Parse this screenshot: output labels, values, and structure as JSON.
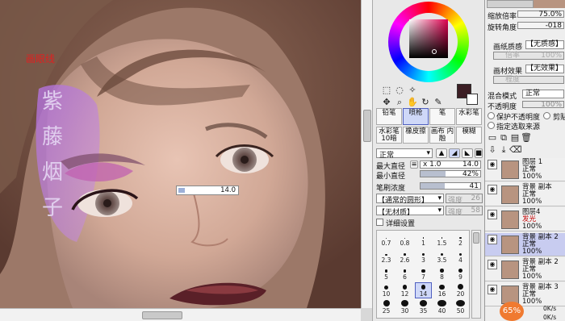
{
  "canvas": {
    "annotation_red": "画眼线",
    "annotation_purple": "紫 藤 烟 子",
    "size_popup": "14.0"
  },
  "color_panel": {
    "main_color": "#3c1e24"
  },
  "tool_panel": {
    "brush_tools": [
      {
        "label": "铅笔",
        "selected": false
      },
      {
        "label": "喷枪",
        "selected": true
      },
      {
        "label": "笔",
        "selected": false
      },
      {
        "label": "水彩笔",
        "selected": false
      },
      {
        "label": "水彩笔 10暗",
        "selected": false
      },
      {
        "label": "橡皮擦",
        "selected": false
      },
      {
        "label": "画布 内融",
        "selected": false
      },
      {
        "label": "模糊",
        "selected": false
      }
    ],
    "blend_mode": "正常",
    "max_diameter_label": "最大直径",
    "max_diameter_mult": "x 1.0",
    "max_diameter_value": "14.0",
    "min_diameter_label": "最小直径",
    "min_diameter_value": "42%",
    "min_diameter_fraction": 0.42,
    "density_label": "笔刷浓度",
    "density_value": "41",
    "density_fraction": 0.41,
    "shape_select": "【通常的圆形】",
    "shape_strength_label": "强度",
    "shape_strength": "26",
    "texture_select": "【无材质】",
    "texture_strength_label": "强度",
    "texture_strength": "58",
    "detail_settings": "详细设置",
    "size_rows": [
      [
        "0.7",
        "0.8",
        "1",
        "1.5",
        "2"
      ],
      [
        "2.3",
        "2.6",
        "3",
        "3.5",
        "4"
      ],
      [
        "5",
        "6",
        "7",
        "8",
        "9"
      ],
      [
        "10",
        "12",
        "14",
        "16",
        "20"
      ],
      [
        "25",
        "30",
        "35",
        "40",
        "50"
      ]
    ],
    "selected_size": "14"
  },
  "layer_panel": {
    "zoom_label": "缩放倍率",
    "zoom_value": "75.0%",
    "rotate_label": "旋转角度",
    "rotate_value": "-018",
    "paper_label": "画纸质感",
    "paper_value": "【无质感】",
    "paper_rate": "倍率",
    "paper_pct": "100%",
    "material_label": "画材效果",
    "material_value": "【无效果】",
    "material_degree": "程度",
    "blend_label": "混合模式",
    "blend_value": "正常",
    "opacity_label": "不透明度",
    "opacity_value": "100%",
    "protect_opacity": "保护不透明度",
    "clip_label": "剪贴",
    "specify_source": "指定选取来源",
    "layers": [
      {
        "name": "图层 1",
        "mode": "正常",
        "opacity": "100%",
        "mode_color": "#000000",
        "selected": false
      },
      {
        "name": "背景 副本",
        "mode": "正常",
        "opacity": "100%",
        "mode_color": "#000000",
        "selected": false
      },
      {
        "name": "图层4",
        "mode": "发光",
        "opacity": "100%",
        "mode_color": "#c00000",
        "selected": false
      },
      {
        "name": "背景 副本 2",
        "mode": "正常",
        "opacity": "100%",
        "mode_color": "#000000",
        "selected": true
      },
      {
        "name": "背景 副本 2",
        "mode": "正常",
        "opacity": "100%",
        "mode_color": "#000000",
        "selected": false
      },
      {
        "name": "背景 副本 3",
        "mode": "正常",
        "opacity": "100%",
        "mode_color": "#000000",
        "selected": false
      }
    ],
    "perf_percent": "65%",
    "net_up": "0K/s",
    "net_down": "0K/s"
  }
}
